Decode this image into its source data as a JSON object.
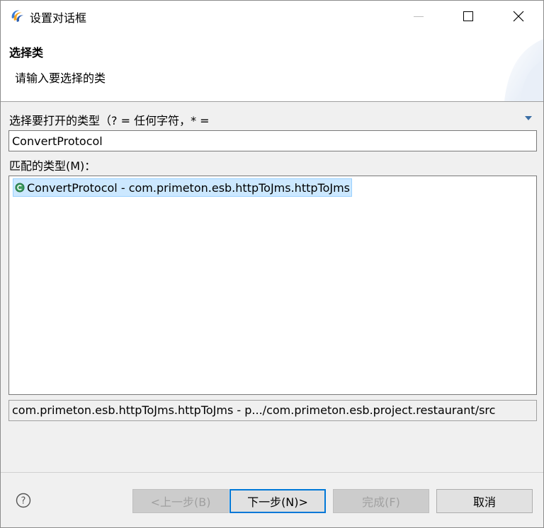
{
  "window": {
    "title": "设置对话框",
    "app_icon": "eclipse-swirl-icon",
    "controls": {
      "minimize": "minimize-icon",
      "maximize": "maximize-icon",
      "close": "×"
    }
  },
  "header": {
    "title": "选择类",
    "description": "请输入要选择的类"
  },
  "filter": {
    "label": "选择要打开的类型（? = 任何字符，* =",
    "value": "ConvertProtocol",
    "history_icon": "dropdown-triangle-icon"
  },
  "matches": {
    "label": "匹配的类型(M)：",
    "items": [
      {
        "text": "ConvertProtocol - com.primeton.esb.httpToJms.httpToJms",
        "icon": "class-icon",
        "selected": true
      }
    ]
  },
  "status": {
    "text": "com.primeton.esb.httpToJms.httpToJms - p.../com.primeton.esb.project.restaurant/src"
  },
  "buttons": {
    "back": "<上一步(B)",
    "next": "下一步(N)>",
    "finish": "完成(F)",
    "cancel": "取消"
  },
  "colors": {
    "selection": "#cce8ff",
    "accent": "#0078d7",
    "class_icon": "#2e8b57"
  }
}
